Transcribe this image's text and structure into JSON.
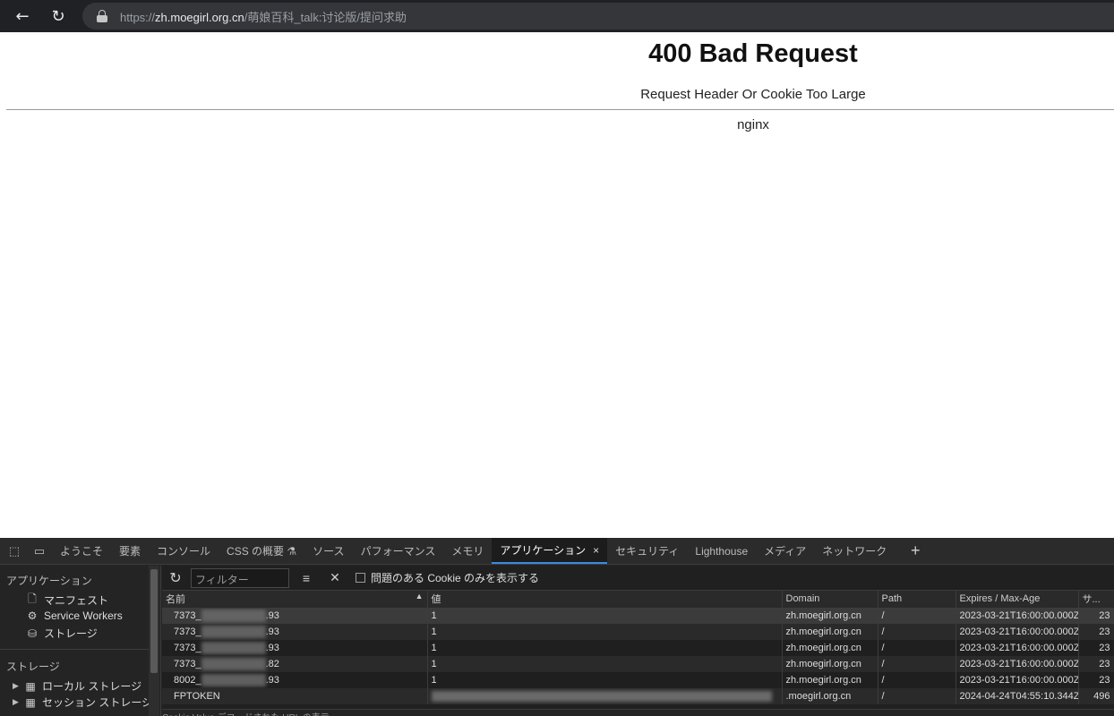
{
  "browser": {
    "url_scheme": "https://",
    "url_host": "zh.moegirl.org.cn",
    "url_path": "/萌娘百科_talk:讨论版/提问求助"
  },
  "page": {
    "title": "400 Bad Request",
    "subtitle": "Request Header Or Cookie Too Large",
    "server": "nginx"
  },
  "devtools": {
    "tabs": [
      {
        "label": "ようこそ"
      },
      {
        "label": "要素"
      },
      {
        "label": "コンソール"
      },
      {
        "label": "CSS の概要 ⚗"
      },
      {
        "label": "ソース"
      },
      {
        "label": "パフォーマンス"
      },
      {
        "label": "メモリ"
      },
      {
        "label": "アプリケーション",
        "active": true
      },
      {
        "label": "セキュリティ"
      },
      {
        "label": "Lighthouse"
      },
      {
        "label": "メディア"
      },
      {
        "label": "ネットワーク"
      }
    ],
    "sidebar": {
      "section_app": "アプリケーション",
      "manifest": "マニフェスト",
      "service_workers": "Service Workers",
      "storage_item": "ストレージ",
      "section_storage": "ストレージ",
      "local_storage": "ローカル ストレージ",
      "session_storage": "セッション ストレージ"
    },
    "toolbar": {
      "filter_placeholder": "フィルター",
      "checkbox_label": "問題のある Cookie のみを表示する"
    },
    "table": {
      "headers": {
        "name": "名前",
        "value": "値",
        "domain": "Domain",
        "path": "Path",
        "expires": "Expires / Max-Age",
        "size": "サ..."
      },
      "rows": [
        {
          "name_start": "7373_",
          "name_end": ".93",
          "value": "1",
          "domain": "zh.moegirl.org.cn",
          "path": "/",
          "expires": "2023-03-21T16:00:00.000Z",
          "size": "23"
        },
        {
          "name_start": "7373_",
          "name_end": ".93",
          "value": "1",
          "domain": "zh.moegirl.org.cn",
          "path": "/",
          "expires": "2023-03-21T16:00:00.000Z",
          "size": "23"
        },
        {
          "name_start": "7373_",
          "name_end": ".93",
          "value": "1",
          "domain": "zh.moegirl.org.cn",
          "path": "/",
          "expires": "2023-03-21T16:00:00.000Z",
          "size": "23"
        },
        {
          "name_start": "7373_",
          "name_end": ".82",
          "value": "1",
          "domain": "zh.moegirl.org.cn",
          "path": "/",
          "expires": "2023-03-21T16:00:00.000Z",
          "size": "23"
        },
        {
          "name_start": "8002_",
          "name_end": ".93",
          "value": "1",
          "domain": "zh.moegirl.org.cn",
          "path": "/",
          "expires": "2023-03-21T16:00:00.000Z",
          "size": "23"
        },
        {
          "name_start": "FPTOKEN",
          "name_end": "",
          "value": "",
          "domain": ".moegirl.org.cn",
          "path": "/",
          "expires": "2024-04-24T04:55:10.344Z",
          "size": "496"
        }
      ]
    },
    "bottom_partial": "Cookie Value    デコードされた URL の表示"
  }
}
